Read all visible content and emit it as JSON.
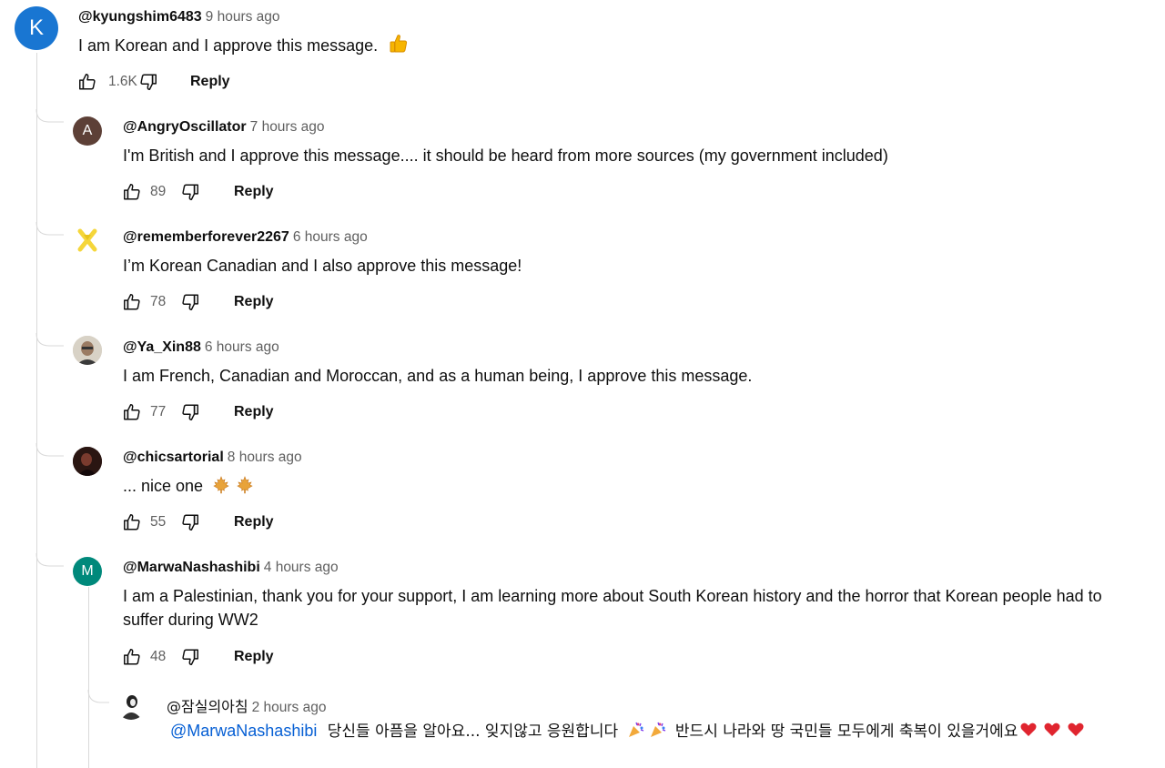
{
  "colors": {
    "avatar_k": "#1976d2",
    "avatar_a": "#5d4037",
    "avatar_m": "#00897b",
    "mention": "#065fd4",
    "muted": "#606060"
  },
  "top_comment": {
    "avatar_letter": "K",
    "author": "@kyungshim6483",
    "time": "9 hours ago",
    "text": "I am Korean and I approve this message.",
    "emoji": "thumbs-up",
    "likes": "1.6K",
    "reply_label": "Reply"
  },
  "replies": [
    {
      "avatar_letter": "A",
      "author": "@AngryOscillator",
      "time": "7 hours ago",
      "text": "I'm British and I approve this message.... it should be heard from more sources (my government included)",
      "likes": "89",
      "reply_label": "Reply"
    },
    {
      "avatar_icon": "yellow-ribbon-avatar",
      "author": "@rememberforever2267",
      "time": "6 hours ago",
      "text": "I’m Korean Canadian and I also approve this message!",
      "likes": "78",
      "reply_label": "Reply"
    },
    {
      "avatar_icon": "profile-photo-avatar",
      "author": "@Ya_Xin88",
      "time": "6 hours ago",
      "text": "I am French, Canadian and Moroccan, and as a human being, I approve this message.",
      "likes": "77",
      "reply_label": "Reply"
    },
    {
      "avatar_icon": "profile-photo-avatar",
      "author": "@chicsartorial",
      "time": "8 hours ago",
      "text": "... nice one",
      "emoji": "maple-leaf",
      "likes": "55",
      "reply_label": "Reply"
    },
    {
      "avatar_letter": "M",
      "author": "@MarwaNashashibi",
      "time": "4 hours ago",
      "text": "I am a Palestinian, thank you for your support, I am learning more about South Korean history and the horror that Korean people had to suffer during WW2",
      "likes": "48",
      "reply_label": "Reply"
    }
  ],
  "nested_reply": {
    "avatar_icon": "profile-photo-avatar",
    "author": "@잠실의아침",
    "time": "2 hours ago",
    "mention": "@MarwaNashashibi",
    "text_part1": "당신들 아픔을 알아요... 잊지않고 응원합니다",
    "text_part2": "반드시 나라와 땅 국민들 모두에게 축복이 있을거에요"
  }
}
